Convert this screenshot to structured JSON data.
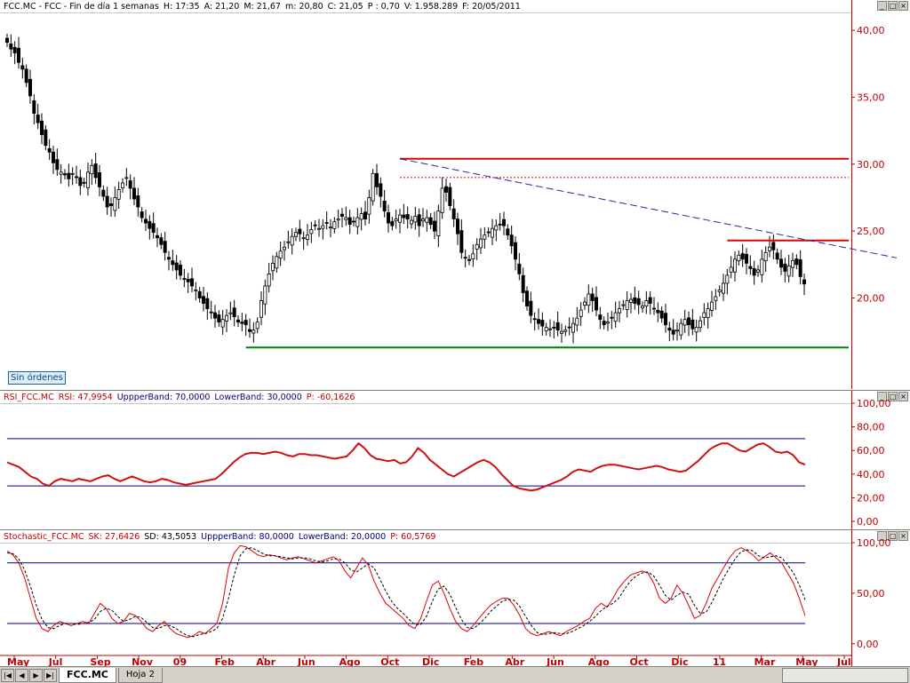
{
  "panes": {
    "price": {
      "header": [
        {
          "text": "FCC.MC - FCC - Fin de día 1 semanas",
          "color": "#000000"
        },
        {
          "text": "H: 17:35",
          "color": "#000000"
        },
        {
          "text": "A: 21,20",
          "color": "#000000"
        },
        {
          "text": "M: 21,67",
          "color": "#000000"
        },
        {
          "text": "m: 20,80",
          "color": "#000000"
        },
        {
          "text": "C: 21,05",
          "color": "#000000"
        },
        {
          "text": "P : 0,70",
          "color": "#000000"
        },
        {
          "text": "V: 1.958.289",
          "color": "#000000"
        },
        {
          "text": "F: 20/05/2011",
          "color": "#000000"
        }
      ],
      "badge": "Sin órdenes"
    },
    "rsi": {
      "header": [
        {
          "text": "RSI_FCC.MC",
          "color": "#c00000"
        },
        {
          "text": "RSI: 47,9954",
          "color": "#c00000"
        },
        {
          "text": "UppperBand: 70,0000",
          "color": "#000080"
        },
        {
          "text": "LowerBand: 30,0000",
          "color": "#000080"
        },
        {
          "text": "P: -60,1626",
          "color": "#c00000"
        }
      ]
    },
    "stoch": {
      "header": [
        {
          "text": "Stochastic_FCC.MC",
          "color": "#c00000"
        },
        {
          "text": "SK: 27,6426",
          "color": "#c00000"
        },
        {
          "text": "SD: 43,5053",
          "color": "#000000"
        },
        {
          "text": "UppperBand: 80,0000",
          "color": "#000080"
        },
        {
          "text": "LowerBand: 20,0000",
          "color": "#000080"
        },
        {
          "text": "P: 60,5769",
          "color": "#c00000"
        }
      ]
    }
  },
  "window_buttons": [
    "_",
    "□",
    "×"
  ],
  "sheet_tabs": [
    "FCC.MC",
    "Hoja 2"
  ],
  "colors": {
    "axis": "#c00000",
    "resistance": "#e00000",
    "support": "#008000",
    "trendline": "#1e2aa0",
    "band": "#000080",
    "rsi_line": "#d01010",
    "sk_line": "#e00000",
    "sd_line": "#000000"
  },
  "chart_data": [
    {
      "type": "candlestick",
      "x_ticks": [
        "May",
        "Jul",
        "Sep",
        "Nov",
        "09",
        "Feb",
        "Abr",
        "Jun",
        "Ago",
        "Oct",
        "Dic",
        "Feb",
        "Abr",
        "Jun",
        "Ago",
        "Oct",
        "Dic",
        "11",
        "Mar",
        "May",
        "Jul"
      ],
      "yticks": [
        "40,00",
        "35,00",
        "30,00",
        "25,00",
        "20,00"
      ],
      "ylim": [
        13.6,
        41.2
      ],
      "weekly_close": [
        39.1,
        38.6,
        38.3,
        37.6,
        37.1,
        36.1,
        35.1,
        33.8,
        33.1,
        32.2,
        31.4,
        30.9,
        30.1,
        29.6,
        29.4,
        29.2,
        28.9,
        29.3,
        29.0,
        28.4,
        28.6,
        29.4,
        29.9,
        29.0,
        28.3,
        27.6,
        26.8,
        26.9,
        27.5,
        28.1,
        28.6,
        29.0,
        28.2,
        27.4,
        26.8,
        26.0,
        25.6,
        25.2,
        24.9,
        24.5,
        24.0,
        23.4,
        22.9,
        22.5,
        22.1,
        21.7,
        21.4,
        21.2,
        20.9,
        20.6,
        20.0,
        19.6,
        19.2,
        18.9,
        18.5,
        18.2,
        18.4,
        18.7,
        18.9,
        18.6,
        18.2,
        18.1,
        18.0,
        17.5,
        17.6,
        18.2,
        19.8,
        20.9,
        21.8,
        22.6,
        23.1,
        23.5,
        23.8,
        24.2,
        24.6,
        24.9,
        24.8,
        24.5,
        24.7,
        25.1,
        25.4,
        25.2,
        25.4,
        25.6,
        25.3,
        25.7,
        25.9,
        26.1,
        26.0,
        25.5,
        25.7,
        26.0,
        26.3,
        25.9,
        27.5,
        29.3,
        28.3,
        27.6,
        26.5,
        25.6,
        25.4,
        25.9,
        26.2,
        26.0,
        25.9,
        25.8,
        26.1,
        25.4,
        25.9,
        26.0,
        25.5,
        25.0,
        26.5,
        28.2,
        27.9,
        26.9,
        25.9,
        24.8,
        23.4,
        23.0,
        22.8,
        23.3,
        24.0,
        24.4,
        24.7,
        24.9,
        25.2,
        25.4,
        25.5,
        25.4,
        24.7,
        23.9,
        22.9,
        21.8,
        20.4,
        19.4,
        18.7,
        18.4,
        18.1,
        17.9,
        17.8,
        17.7,
        17.8,
        17.6,
        17.5,
        17.6,
        17.8,
        18.1,
        18.5,
        19.1,
        19.7,
        20.3,
        19.8,
        19.1,
        18.4,
        18.0,
        18.2,
        18.5,
        18.9,
        19.2,
        19.5,
        19.8,
        19.9,
        19.6,
        19.5,
        19.4,
        19.8,
        19.6,
        19.2,
        18.9,
        18.5,
        18.0,
        17.6,
        17.3,
        17.6,
        18.1,
        18.4,
        18.0,
        17.7,
        17.8,
        18.3,
        18.9,
        19.2,
        19.7,
        20.1,
        20.6,
        21.1,
        21.7,
        22.3,
        22.9,
        23.2,
        22.9,
        22.6,
        22.2,
        21.7,
        22.1,
        22.9,
        23.4,
        23.8,
        23.6,
        22.9,
        22.3,
        22.0,
        22.4,
        22.8,
        22.5,
        21.6,
        21.05
      ],
      "levels": {
        "resistance": [
          30.4,
          24.3
        ],
        "resistance_dotted": 29.0,
        "support": 16.3
      },
      "trendline": {
        "from_week": 102,
        "from_value": 30.4,
        "to_week": 231,
        "to_value": 23.0
      }
    },
    {
      "type": "line",
      "name": "RSI",
      "yticks": [
        "100,00",
        "80,00",
        "60,00",
        "40,00",
        "20,00",
        "0,00"
      ],
      "ylim": [
        -6,
        100
      ],
      "bands": [
        70,
        30
      ],
      "values": [
        50,
        48,
        46,
        42,
        38,
        36,
        32,
        30,
        34,
        36,
        35,
        34,
        36,
        35,
        34,
        36,
        38,
        39,
        36,
        34,
        36,
        38,
        36,
        34,
        33,
        34,
        36,
        35,
        33,
        32,
        31,
        32,
        33,
        34,
        35,
        36,
        40,
        45,
        50,
        54,
        57,
        58,
        58,
        57,
        58,
        59,
        58,
        56,
        55,
        57,
        57,
        56,
        56,
        55,
        54,
        53,
        54,
        55,
        60,
        66,
        62,
        56,
        53,
        52,
        51,
        52,
        49,
        50,
        55,
        62,
        58,
        52,
        48,
        44,
        40,
        38,
        41,
        44,
        47,
        50,
        52,
        50,
        46,
        40,
        35,
        30,
        28,
        27,
        26,
        27,
        29,
        31,
        33,
        35,
        38,
        42,
        44,
        43,
        42,
        45,
        47,
        48,
        48,
        47,
        46,
        45,
        44,
        45,
        46,
        47,
        46,
        44,
        43,
        42,
        43,
        47,
        51,
        56,
        61,
        64,
        66,
        66,
        63,
        60,
        59,
        62,
        65,
        66,
        63,
        59,
        58,
        59,
        56,
        50,
        48.0
      ]
    },
    {
      "type": "line",
      "name": "Stochastic",
      "yticks": [
        "100,00",
        "50,00",
        "0,00"
      ],
      "ylim": [
        -9,
        100
      ],
      "bands": [
        80,
        20
      ],
      "series": [
        {
          "name": "SK",
          "values": [
            92,
            88,
            80,
            65,
            45,
            25,
            15,
            12,
            18,
            22,
            20,
            18,
            20,
            22,
            20,
            30,
            40,
            35,
            25,
            20,
            22,
            30,
            28,
            22,
            15,
            12,
            18,
            22,
            15,
            10,
            8,
            6,
            8,
            12,
            10,
            15,
            20,
            40,
            75,
            90,
            97,
            96,
            92,
            88,
            86,
            88,
            87,
            85,
            83,
            85,
            86,
            84,
            82,
            80,
            82,
            84,
            86,
            82,
            72,
            65,
            75,
            85,
            78,
            62,
            50,
            40,
            35,
            30,
            25,
            18,
            15,
            25,
            42,
            58,
            62,
            50,
            35,
            22,
            15,
            12,
            18,
            25,
            32,
            38,
            42,
            45,
            45,
            38,
            28,
            15,
            10,
            8,
            10,
            12,
            10,
            8,
            12,
            15,
            18,
            22,
            25,
            35,
            40,
            36,
            45,
            55,
            62,
            68,
            70,
            72,
            70,
            60,
            45,
            40,
            45,
            58,
            50,
            38,
            25,
            28,
            40,
            55,
            65,
            75,
            85,
            92,
            95,
            92,
            88,
            82,
            86,
            90,
            85,
            80,
            70,
            60,
            45,
            27.6
          ]
        },
        {
          "name": "SD",
          "values": [
            90,
            89,
            84,
            73,
            57,
            38,
            24,
            16,
            15,
            18,
            20,
            20,
            19,
            20,
            21,
            24,
            32,
            35,
            33,
            27,
            22,
            24,
            27,
            26,
            21,
            16,
            15,
            18,
            18,
            15,
            11,
            8,
            7,
            9,
            10,
            12,
            15,
            25,
            45,
            68,
            87,
            94,
            95,
            92,
            89,
            87,
            87,
            86,
            85,
            84,
            85,
            85,
            84,
            82,
            81,
            82,
            84,
            84,
            80,
            73,
            71,
            75,
            79,
            75,
            64,
            52,
            42,
            35,
            30,
            24,
            19,
            19,
            27,
            42,
            54,
            57,
            49,
            36,
            24,
            16,
            15,
            19,
            25,
            32,
            37,
            42,
            44,
            43,
            37,
            27,
            18,
            11,
            9,
            10,
            11,
            10,
            10,
            12,
            15,
            18,
            22,
            27,
            33,
            37,
            40,
            45,
            54,
            62,
            67,
            70,
            71,
            67,
            58,
            48,
            43,
            48,
            51,
            49,
            38,
            30,
            31,
            41,
            53,
            65,
            75,
            84,
            91,
            93,
            92,
            87,
            85,
            86,
            87,
            85,
            78,
            70,
            58,
            43.5
          ]
        }
      ]
    }
  ]
}
